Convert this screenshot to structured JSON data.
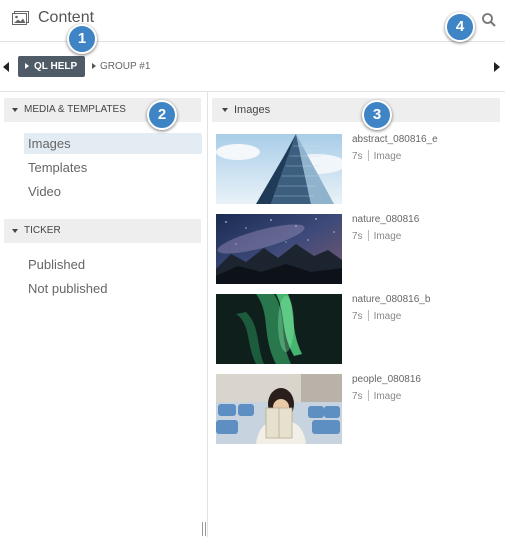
{
  "header": {
    "title": "Content",
    "app_icon": "image-gallery-icon",
    "search_icon": "search-icon"
  },
  "group_bar": {
    "active_chip": "QL HELP",
    "chip": "GROUP #1"
  },
  "sidebar": {
    "sections": [
      {
        "label": "MEDIA & TEMPLATES",
        "items": [
          "Images",
          "Templates",
          "Video"
        ],
        "selected": "Images"
      },
      {
        "label": "TICKER",
        "items": [
          "Published",
          "Not published"
        ]
      }
    ]
  },
  "main": {
    "header": "Images",
    "items": [
      {
        "name": "abstract_080816_e",
        "duration": "7s",
        "type": "Image"
      },
      {
        "name": "nature_080816",
        "duration": "7s",
        "type": "Image"
      },
      {
        "name": "nature_080816_b",
        "duration": "7s",
        "type": "Image"
      },
      {
        "name": "people_080816",
        "duration": "7s",
        "type": "Image"
      }
    ]
  },
  "callouts": [
    "1",
    "2",
    "3",
    "4"
  ],
  "colors": {
    "callout": "#3f85c6",
    "active_chip": "#4f5b66",
    "selected_item": "#e3ebf3",
    "section_header": "#eeeeee"
  }
}
